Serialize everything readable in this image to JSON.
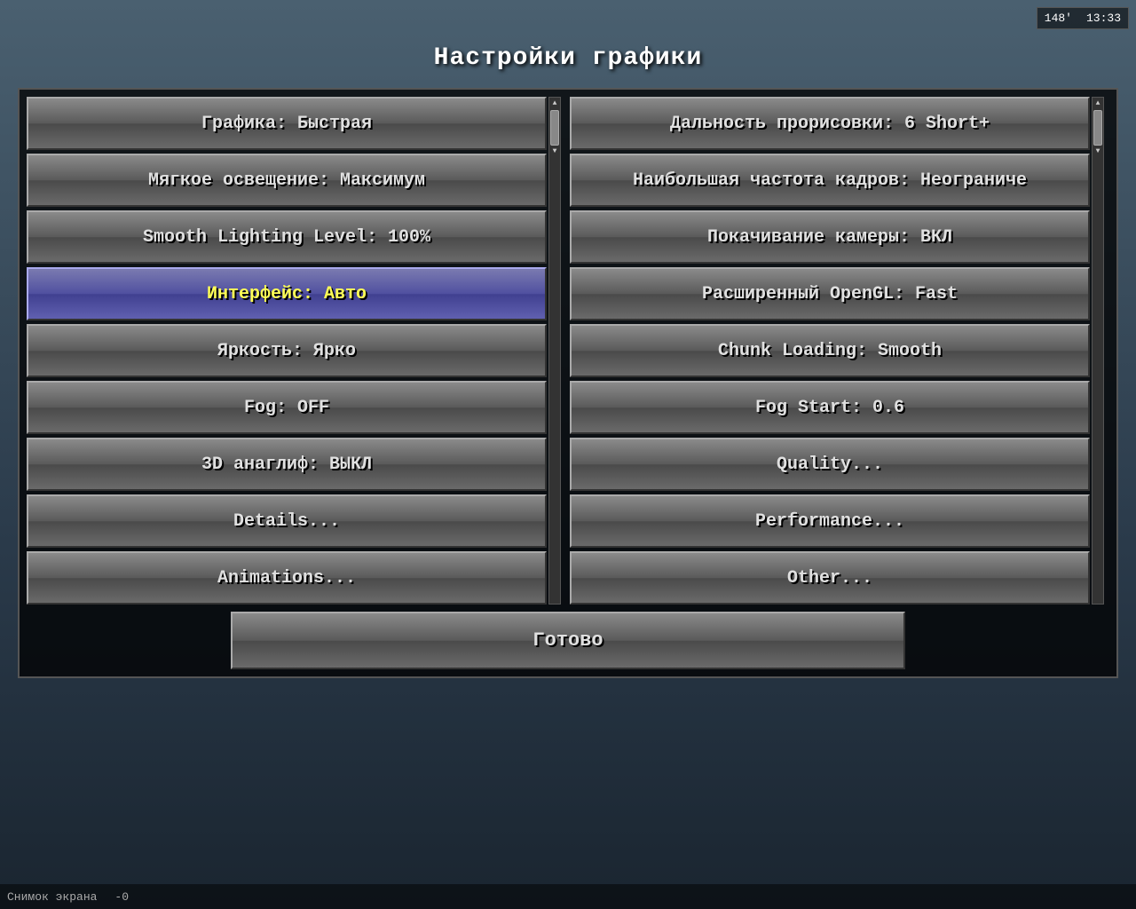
{
  "hud": {
    "distance": "148'",
    "time": "13:33"
  },
  "dialog": {
    "title": "Настройки графики",
    "left_buttons": [
      {
        "id": "graphics",
        "label": "Графика: Быстрая",
        "highlighted": false
      },
      {
        "id": "smooth-lighting",
        "label": "Мягкое освещение: Максимум",
        "highlighted": false
      },
      {
        "id": "smooth-lighting-level",
        "label": "Smooth Lighting Level: 100%",
        "highlighted": false
      },
      {
        "id": "interface",
        "label": "Интерфейс: Авто",
        "highlighted": true
      },
      {
        "id": "brightness",
        "label": "Яркость: Ярко",
        "highlighted": false
      },
      {
        "id": "fog",
        "label": "Fog: OFF",
        "highlighted": false
      },
      {
        "id": "anaglyph",
        "label": "3D анаглиф: ВЫКЛ",
        "highlighted": false
      },
      {
        "id": "details",
        "label": "Details...",
        "highlighted": false
      },
      {
        "id": "animations",
        "label": "Animations...",
        "highlighted": false
      }
    ],
    "right_buttons": [
      {
        "id": "render-distance",
        "label": "Дальность прорисовки: 6 Short+",
        "highlighted": false
      },
      {
        "id": "max-fps",
        "label": "Наибольшая частота кадров: Неограниче",
        "highlighted": false
      },
      {
        "id": "camera-bob",
        "label": "Покачивание камеры: ВКЛ",
        "highlighted": false
      },
      {
        "id": "opengl",
        "label": "Расширенный OpenGL: Fast",
        "highlighted": false
      },
      {
        "id": "chunk-loading",
        "label": "Chunk Loading: Smooth",
        "highlighted": false
      },
      {
        "id": "fog-start",
        "label": "Fog Start: 0.6",
        "highlighted": false
      },
      {
        "id": "quality",
        "label": "Quality...",
        "highlighted": false
      },
      {
        "id": "performance",
        "label": "Performance...",
        "highlighted": false
      },
      {
        "id": "other",
        "label": "Other...",
        "highlighted": false
      }
    ],
    "done_button": "Готово"
  },
  "statusbar": {
    "screenshot": "Снимок экрана",
    "coords": "-0"
  }
}
